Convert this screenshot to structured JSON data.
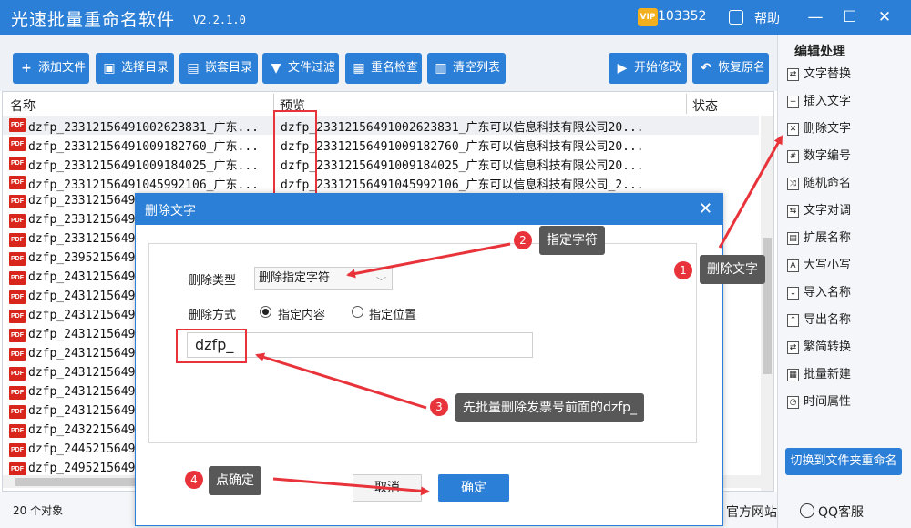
{
  "app": {
    "title": "光速批量重命名软件",
    "version": "V2.2.1.0",
    "vip_badge": "VIP",
    "vip_number": "103352",
    "help": "帮助"
  },
  "window_controls": {
    "minimize": "—",
    "maximize": "☐",
    "close": "✕"
  },
  "toolbar": {
    "add_file": "添加文件",
    "select_dir": "选择目录",
    "nested_dir": "嵌套目录",
    "file_filter": "文件过滤",
    "rename_check": "重名检查",
    "clear_list": "清空列表",
    "start": "开始修改",
    "restore": "恢复原名"
  },
  "right_panel": {
    "title": "编辑处理",
    "items": [
      "文字替换",
      "插入文字",
      "删除文字",
      "数字编号",
      "随机命名",
      "文字对调",
      "扩展名称",
      "大写小写",
      "导入名称",
      "导出名称",
      "繁简转换",
      "批量新建",
      "时间属性"
    ],
    "switch_button": "切换到文件夹重命名"
  },
  "list": {
    "columns": {
      "name": "名称",
      "preview": "预览",
      "status": "状态"
    },
    "rows": [
      {
        "name": "dzfp_23312156491002623831_广东...",
        "preview": "dzfp_23312156491002623831_广东可以信息科技有限公司20..."
      },
      {
        "name": "dzfp_23312156491009182760_广东...",
        "preview": "dzfp_23312156491009182760_广东可以信息科技有限公司20..."
      },
      {
        "name": "dzfp_23312156491009184025_广东...",
        "preview": "dzfp_23312156491009184025_广东可以信息科技有限公司20..."
      },
      {
        "name": "dzfp_23312156491045992106_广东...",
        "preview": "dzfp_23312156491045992106_广东可以信息科技有限公司_2..."
      },
      {
        "name": "dzfp_2331215649",
        "preview": ""
      },
      {
        "name": "dzfp_2331215649",
        "preview": ""
      },
      {
        "name": "dzfp_2331215649",
        "preview": ""
      },
      {
        "name": "dzfp_2395215649",
        "preview": ""
      },
      {
        "name": "dzfp_2431215649",
        "preview": ""
      },
      {
        "name": "dzfp_2431215649",
        "preview": ""
      },
      {
        "name": "dzfp_2431215649",
        "preview": ""
      },
      {
        "name": "dzfp_2431215649",
        "preview": ""
      },
      {
        "name": "dzfp_2431215649",
        "preview": ""
      },
      {
        "name": "dzfp_2431215649",
        "preview": ""
      },
      {
        "name": "dzfp_2431215649",
        "preview": ""
      },
      {
        "name": "dzfp_2431215649",
        "preview": ""
      },
      {
        "name": "dzfp_2432215649",
        "preview": ""
      },
      {
        "name": "dzfp_2445215649",
        "preview": ""
      },
      {
        "name": "dzfp_2495215649",
        "preview": ""
      }
    ],
    "file_icon": "PDF"
  },
  "status_bar": {
    "count": "20 个对象",
    "website": "官方网站",
    "qq": "QQ客服"
  },
  "dialog": {
    "title": "删除文字",
    "close": "✕",
    "type_label": "删除类型",
    "type_value": "删除指定字符",
    "method_label": "删除方式",
    "option_content": "指定内容",
    "option_position": "指定位置",
    "input_value": "dzfp_",
    "cancel": "取消",
    "ok": "确定"
  },
  "annotations": {
    "n1": "1",
    "t1": "删除文字",
    "n2": "2",
    "t2": "指定字符",
    "n3": "3",
    "t3": "先批量删除发票号前面的dzfp_",
    "n4": "4",
    "t4": "点确定"
  },
  "colors": {
    "accent": "#2b7fd6",
    "annotation_red": "#e8333b",
    "tooltip": "#585858",
    "pdf_icon": "#d9261c"
  }
}
